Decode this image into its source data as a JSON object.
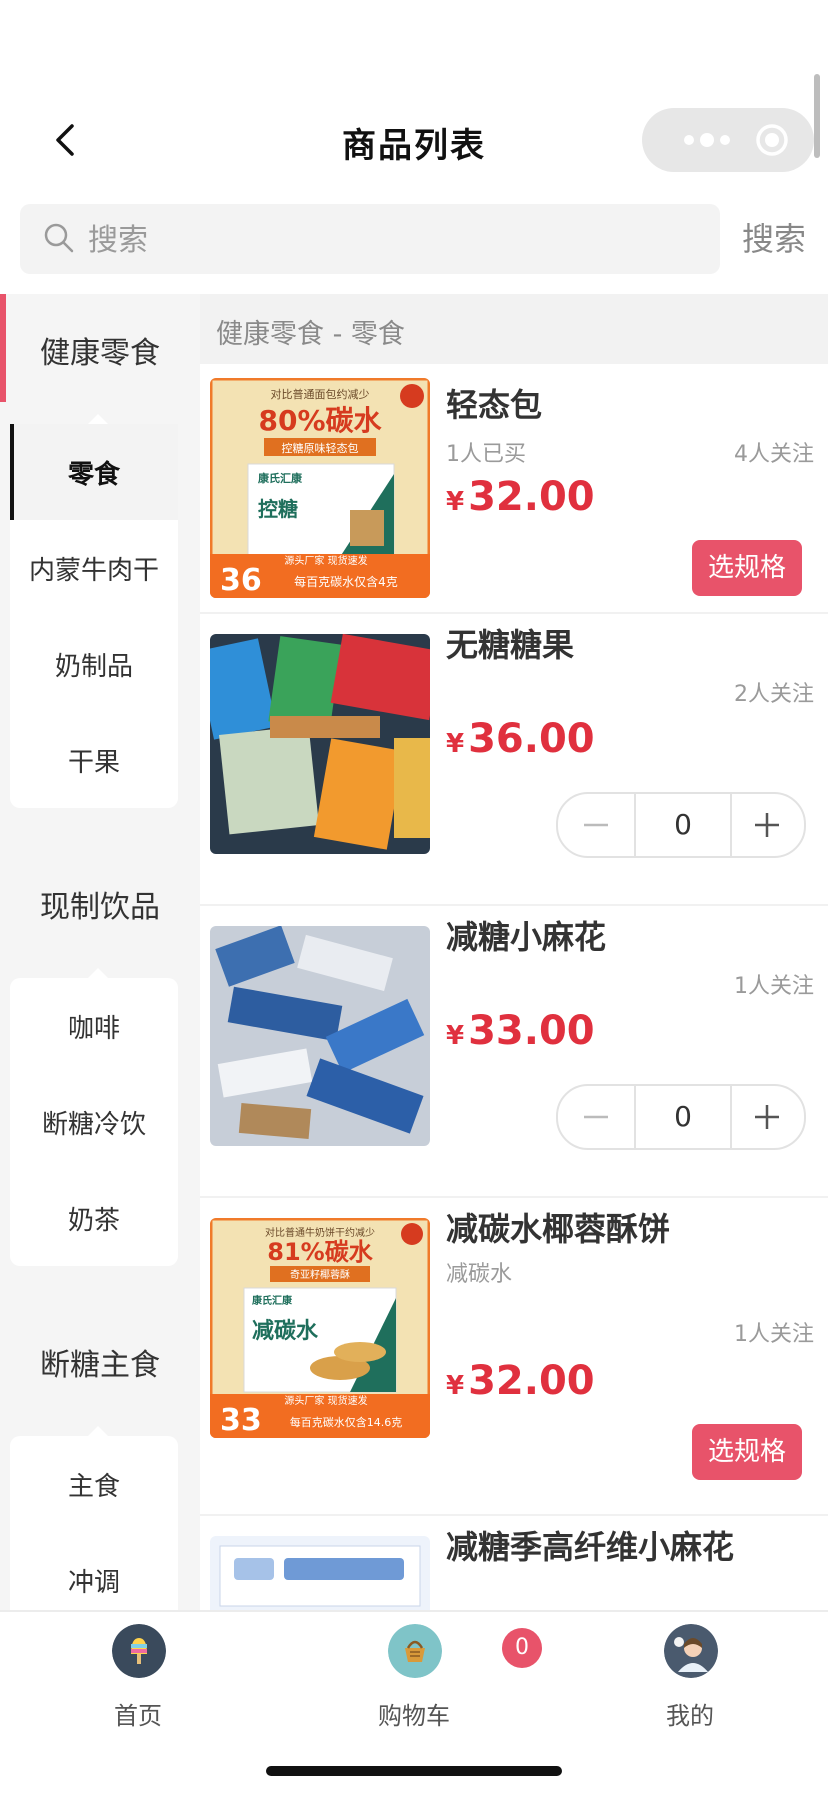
{
  "header": {
    "title": "商品列表"
  },
  "search": {
    "placeholder": "搜索",
    "button_label": "搜索"
  },
  "sidebar": {
    "categories": [
      {
        "label": "健康零食",
        "subs": [
          "零食",
          "内蒙牛肉干",
          "奶制品",
          "干果"
        ]
      },
      {
        "label": "现制饮品",
        "subs": [
          "咖啡",
          "断糖冷饮",
          "奶茶"
        ]
      },
      {
        "label": "断糖主食",
        "subs": [
          "主食",
          "冲调"
        ]
      }
    ]
  },
  "list": {
    "header": "健康零食 - 零食",
    "products": [
      {
        "name": "轻态包",
        "buyers": "1人已买",
        "followers": "4人关注",
        "currency": "¥",
        "price": "32.00",
        "action": "选规格",
        "thumb": {
          "top_text": "对比普通面包约减少",
          "headline": "80%碳水",
          "banner": "控糖原味轻态包",
          "brand": "康氏汇康",
          "product": "控糖",
          "big_num": "36",
          "bottom_text": "每百克碳水仅含4克",
          "side_text": "源头厂家 现货速发"
        }
      },
      {
        "name": "无糖糖果",
        "followers": "2人关注",
        "currency": "¥",
        "price": "36.00",
        "qty": "0"
      },
      {
        "name": "减糖小麻花",
        "followers": "1人关注",
        "currency": "¥",
        "price": "33.00",
        "qty": "0"
      },
      {
        "name": "减碳水椰蓉酥饼",
        "subtitle": "减碳水",
        "followers": "1人关注",
        "currency": "¥",
        "price": "32.00",
        "action": "选规格",
        "thumb": {
          "top_text": "对比普通牛奶饼干约减少",
          "headline": "81%碳水",
          "banner": "奇亚籽椰蓉酥",
          "brand": "康氏汇康",
          "product": "减碳水",
          "big_num": "33",
          "bottom_text": "每百克碳水仅含14.6克",
          "side_text": "源头厂家 现货速发"
        }
      },
      {
        "name": "减糖季高纤维小麻花"
      }
    ]
  },
  "tabbar": {
    "home": "首页",
    "cart": "购物车",
    "cart_badge": "0",
    "mine": "我的"
  },
  "colors": {
    "accent": "#e8536a",
    "price": "#e0303e"
  }
}
